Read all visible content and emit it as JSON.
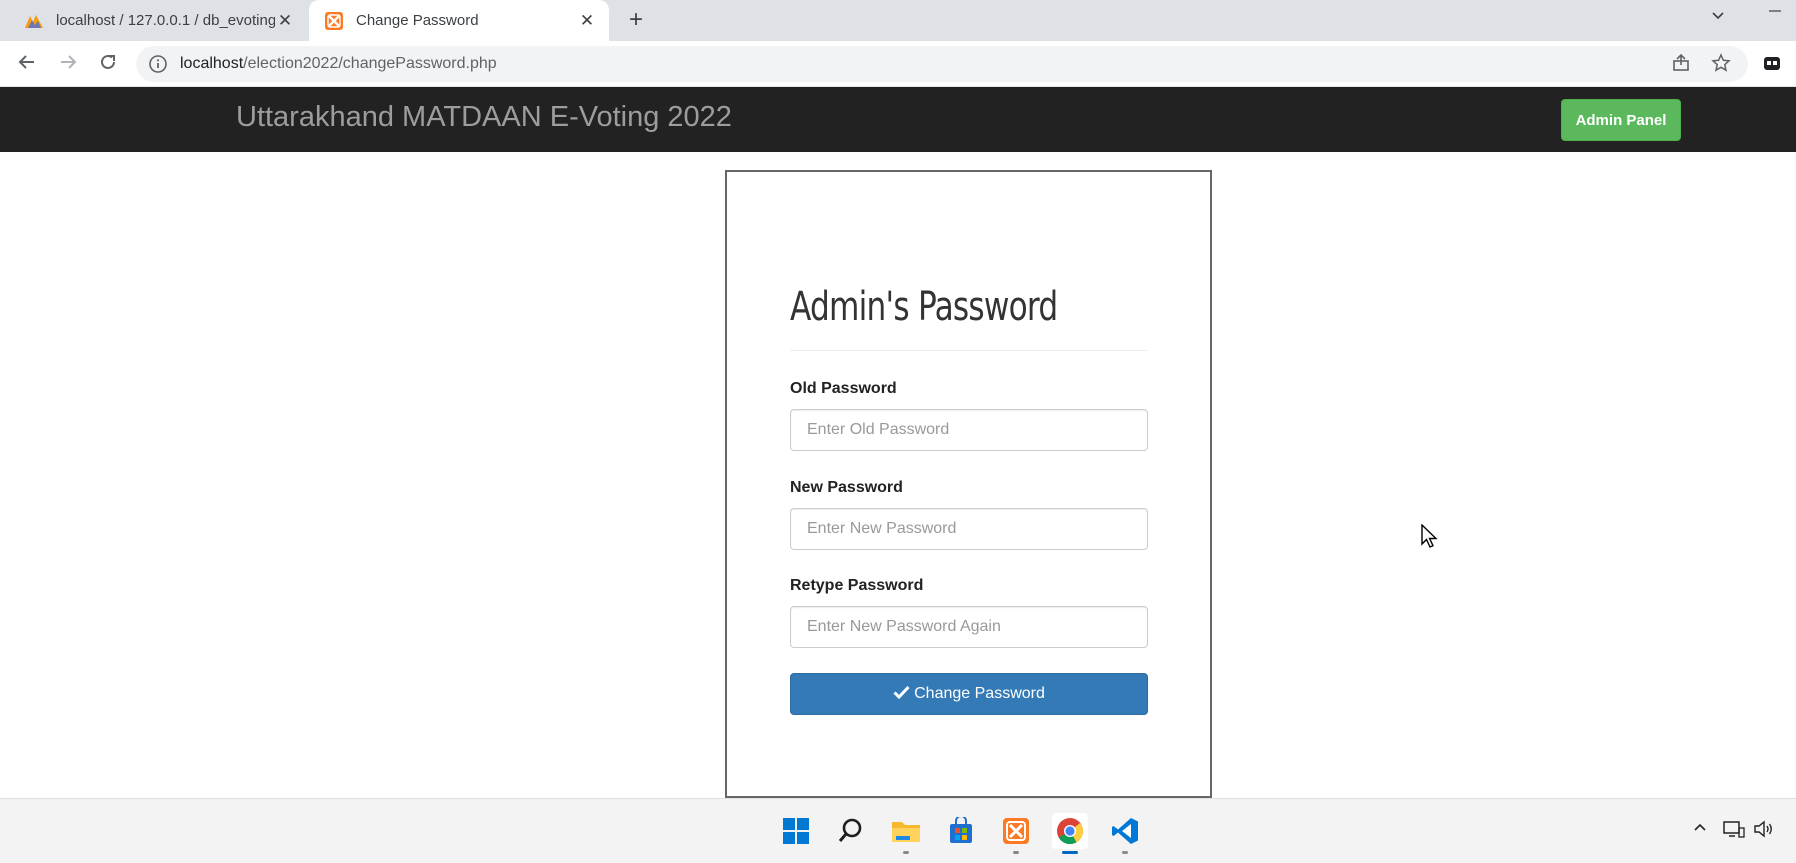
{
  "browser": {
    "tabs": [
      {
        "title": "localhost / 127.0.0.1 / db_evoting",
        "favicon": "phpmyadmin-icon",
        "active": false
      },
      {
        "title": "Change Password",
        "favicon": "xampp-icon",
        "active": true
      }
    ],
    "new_tab_label": "+",
    "address": {
      "host": "localhost",
      "path": "/election2022/changePassword.php"
    }
  },
  "page": {
    "navbar": {
      "brand": "Uttarakhand MATDAAN E-Voting 2022",
      "admin_button": "Admin Panel"
    },
    "form": {
      "heading": "Admin's Password",
      "fields": [
        {
          "label": "Old Password",
          "placeholder": "Enter Old Password"
        },
        {
          "label": "New Password",
          "placeholder": "Enter New Password"
        },
        {
          "label": "Retype Password",
          "placeholder": "Enter New Password Again"
        }
      ],
      "submit_label": "Change Password"
    }
  },
  "colors": {
    "navbar_bg": "#222222",
    "brand_text": "#9d9d9d",
    "success": "#5cb85c",
    "primary": "#337ab7"
  },
  "taskbar": {
    "icons": [
      "windows-start-icon",
      "search-icon",
      "file-explorer-icon",
      "microsoft-store-icon",
      "xampp-icon",
      "chrome-icon",
      "vscode-icon"
    ]
  }
}
